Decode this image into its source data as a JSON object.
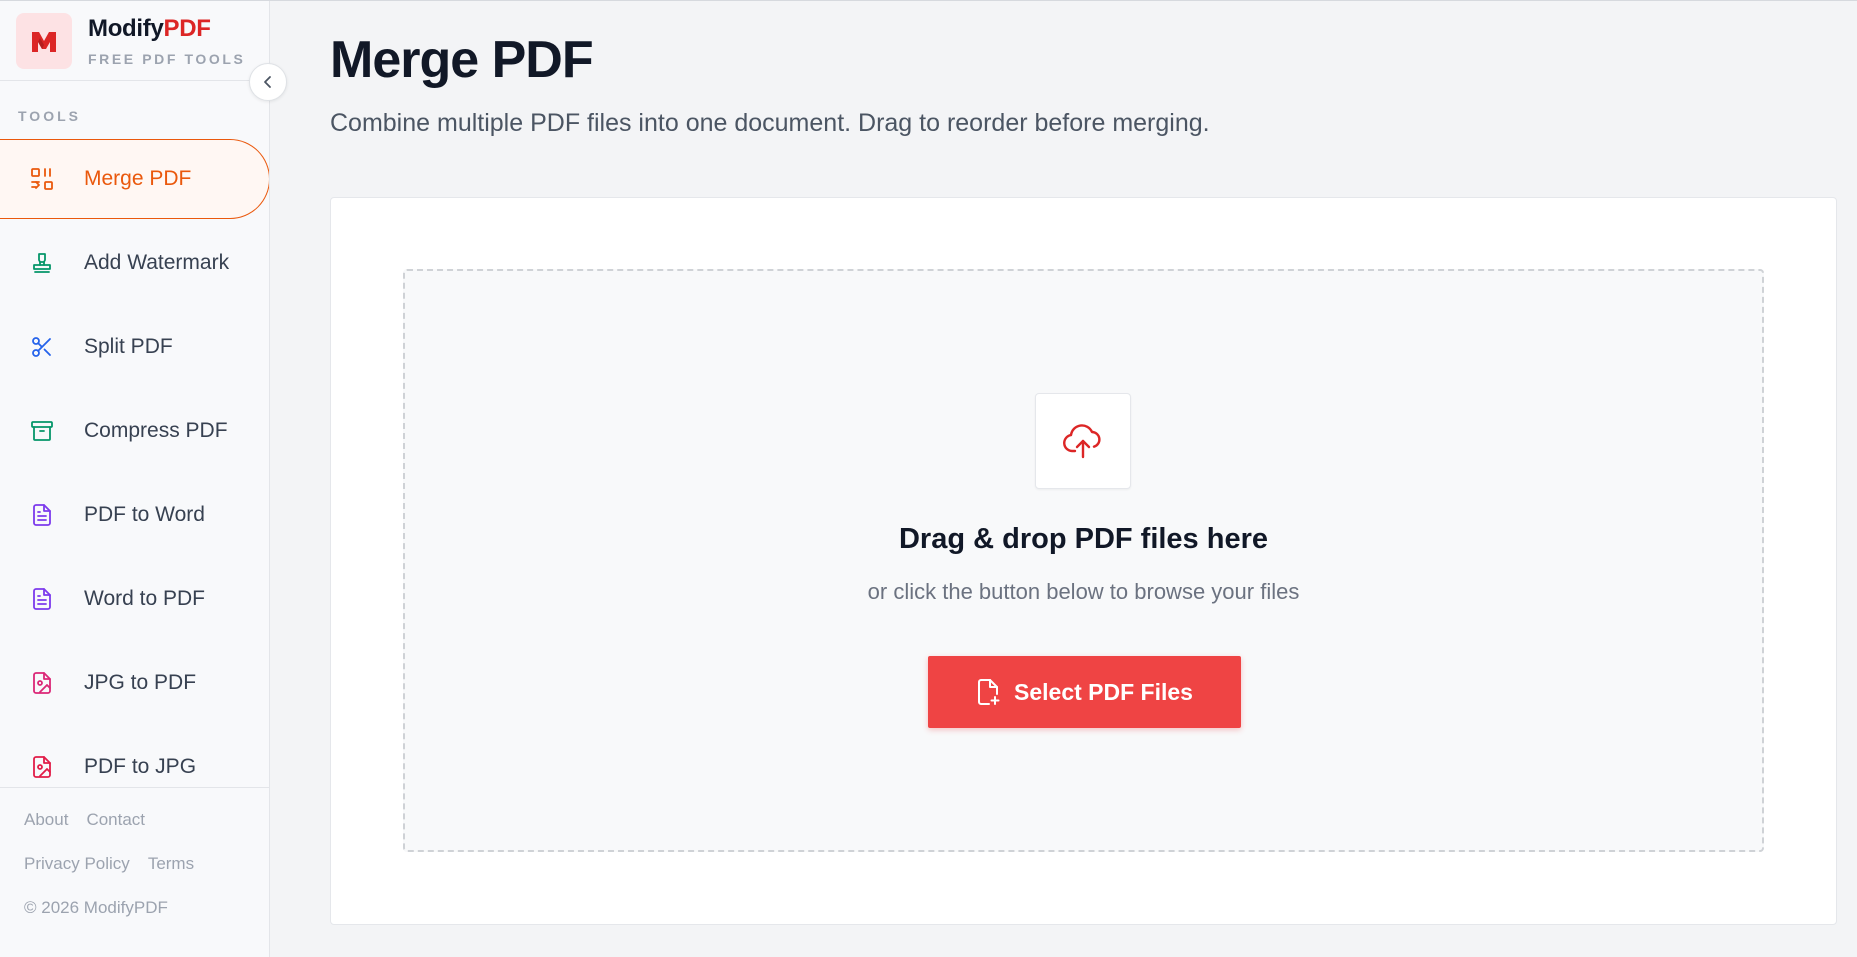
{
  "brand": {
    "name_main": "Modify",
    "name_accent": "PDF",
    "subtitle": "FREE PDF TOOLS",
    "logo_icon": "modifypdf-logo-icon"
  },
  "sidebar": {
    "section_label": "TOOLS",
    "collapse_icon": "chevron-left-icon",
    "items": [
      {
        "label": "Merge PDF",
        "icon": "merge-icon",
        "color": "#ea580c",
        "active": true
      },
      {
        "label": "Add Watermark",
        "icon": "stamp-icon",
        "color": "#059669"
      },
      {
        "label": "Split PDF",
        "icon": "scissors-icon",
        "color": "#2563eb"
      },
      {
        "label": "Compress PDF",
        "icon": "archive-icon",
        "color": "#059669"
      },
      {
        "label": "PDF to Word",
        "icon": "document-icon",
        "color": "#7c3aed"
      },
      {
        "label": "Word to PDF",
        "icon": "document-icon",
        "color": "#7c3aed"
      },
      {
        "label": "JPG to PDF",
        "icon": "image-file-icon",
        "color": "#db2777"
      },
      {
        "label": "PDF to JPG",
        "icon": "image-file-icon",
        "color": "#e11d48"
      }
    ],
    "footer": {
      "about": "About",
      "contact": "Contact",
      "privacy": "Privacy Policy",
      "terms": "Terms",
      "copyright": "© 2026 ModifyPDF"
    }
  },
  "main": {
    "title": "Merge PDF",
    "description": "Combine multiple PDF files into one document. Drag to reorder before merging.",
    "dropzone": {
      "icon": "cloud-upload-icon",
      "title": "Drag & drop PDF files here",
      "subtitle": "or click the button below to browse your files",
      "button_label": "Select PDF Files",
      "button_icon": "file-plus-icon"
    }
  },
  "colors": {
    "accent": "#ea580c",
    "brand_red": "#dc2626",
    "button": "#ef4444"
  }
}
